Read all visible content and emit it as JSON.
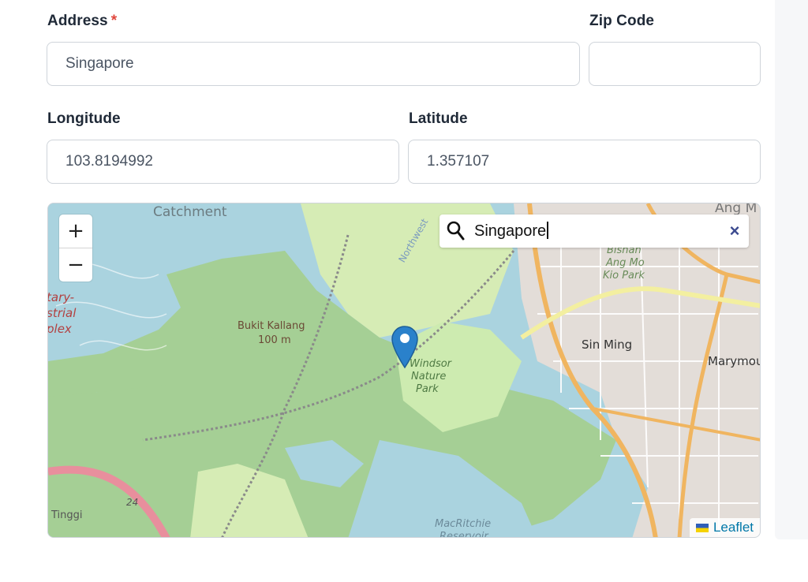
{
  "form": {
    "address": {
      "label": "Address",
      "required_mark": "*",
      "value": "Singapore"
    },
    "zip_code": {
      "label": "Zip Code",
      "value": ""
    },
    "longitude": {
      "label": "Longitude",
      "value": "103.8194992"
    },
    "latitude": {
      "label": "Latitude",
      "value": "1.357107"
    }
  },
  "map": {
    "zoom_in": "+",
    "zoom_out": "−",
    "search": {
      "query": "Singapore",
      "clear": "×",
      "icon": "search-icon"
    },
    "attribution": "Leaflet",
    "marker": "map-pin-icon",
    "place_labels": {
      "catchment": "Catchment",
      "ang_mo": "Ang M",
      "northwest": "Northwest",
      "bishan_1": "Bishan",
      "bishan_2": "Ang Mo",
      "bishan_3": "Kio Park",
      "tary": "tary-",
      "strial": "strial",
      "plex": "plex",
      "bukit_kallang": "Bukit Kallang",
      "elevation": "100 m",
      "sin_ming": "Sin Ming",
      "marymount": "Marymou",
      "windsor_1": "Windsor",
      "windsor_2": "Nature",
      "windsor_3": "Park",
      "road_24": "24",
      "tinggi": "Tinggi",
      "macritchie_1": "MacRitchie",
      "macritchie_2": "Reservoir"
    }
  },
  "colors": {
    "required": "#e0463c",
    "water": "#aad3df",
    "forest": "#a5cf95",
    "park": "#cdebb0",
    "urban": "#e3ddd8",
    "road_orange": "#f0b560",
    "road_yellow": "#f3efa0",
    "link": "#0078a8"
  }
}
